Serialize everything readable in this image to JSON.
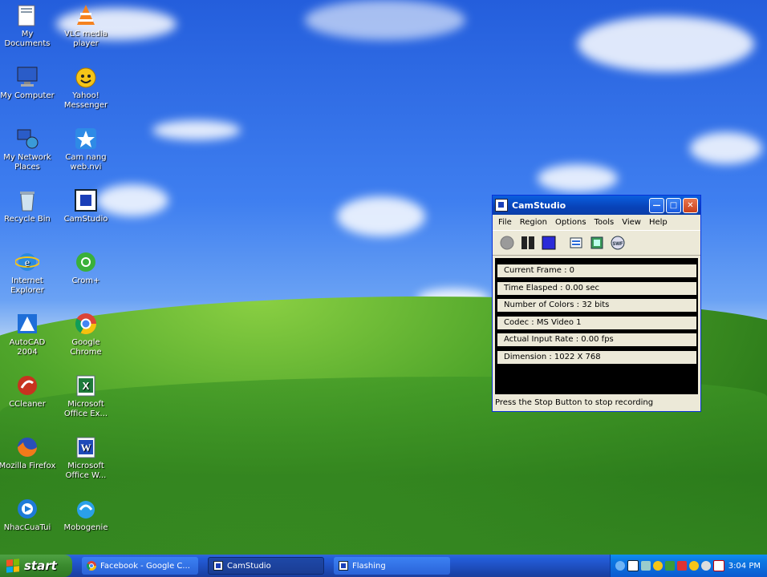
{
  "desktop": {
    "icons": [
      {
        "label": "My Documents",
        "icon": "my-documents-icon"
      },
      {
        "label": "VLC media player",
        "icon": "vlc-icon"
      },
      {
        "label": "My Computer",
        "icon": "my-computer-icon"
      },
      {
        "label": "Yahoo! Messenger",
        "icon": "yahoo-messenger-icon"
      },
      {
        "label": "My Network Places",
        "icon": "network-places-icon"
      },
      {
        "label": "Cam nang web.nvi",
        "icon": "star-icon"
      },
      {
        "label": "Recycle Bin",
        "icon": "recycle-bin-icon"
      },
      {
        "label": "CamStudio",
        "icon": "camstudio-icon"
      },
      {
        "label": "Internet Explorer",
        "icon": "internet-explorer-icon"
      },
      {
        "label": "Crom+",
        "icon": "crom-plus-icon"
      },
      {
        "label": "AutoCAD 2004",
        "icon": "autocad-icon"
      },
      {
        "label": "Google Chrome",
        "icon": "chrome-icon"
      },
      {
        "label": "CCleaner",
        "icon": "ccleaner-icon"
      },
      {
        "label": "Microsoft Office Ex...",
        "icon": "excel-icon"
      },
      {
        "label": "Mozilla Firefox",
        "icon": "firefox-icon"
      },
      {
        "label": "Microsoft Office W...",
        "icon": "word-icon"
      },
      {
        "label": "NhacCuaTui",
        "icon": "nhaccuatui-icon"
      },
      {
        "label": "Mobogenie",
        "icon": "mobogenie-icon"
      }
    ]
  },
  "camstudio": {
    "title": "CamStudio",
    "menu": [
      "File",
      "Region",
      "Options",
      "Tools",
      "View",
      "Help"
    ],
    "toolbar": [
      "record-icon",
      "pause-icon",
      "stop-icon",
      "annotate-icon",
      "video-icon",
      "swf-icon"
    ],
    "swf_label": "SWF",
    "fields": [
      "Current Frame : 0",
      "Time Elasped : 0.00 sec",
      "Number of Colors : 32 bits",
      "Codec : MS Video 1",
      "Actual Input Rate : 0.00 fps",
      "Dimension : 1022 X 768"
    ],
    "status": "Press the Stop Button to stop recording"
  },
  "taskbar": {
    "start_label": "start",
    "tasks": [
      {
        "label": "Facebook - Google C...",
        "active": false
      },
      {
        "label": "CamStudio",
        "active": true
      },
      {
        "label": "Flashing",
        "active": false
      }
    ],
    "clock": "3:04 PM"
  },
  "colors": {
    "sky": "#245edc",
    "grass": "#4fa52a",
    "titlebar": "#0842b8",
    "start": "#3a8a2e"
  }
}
